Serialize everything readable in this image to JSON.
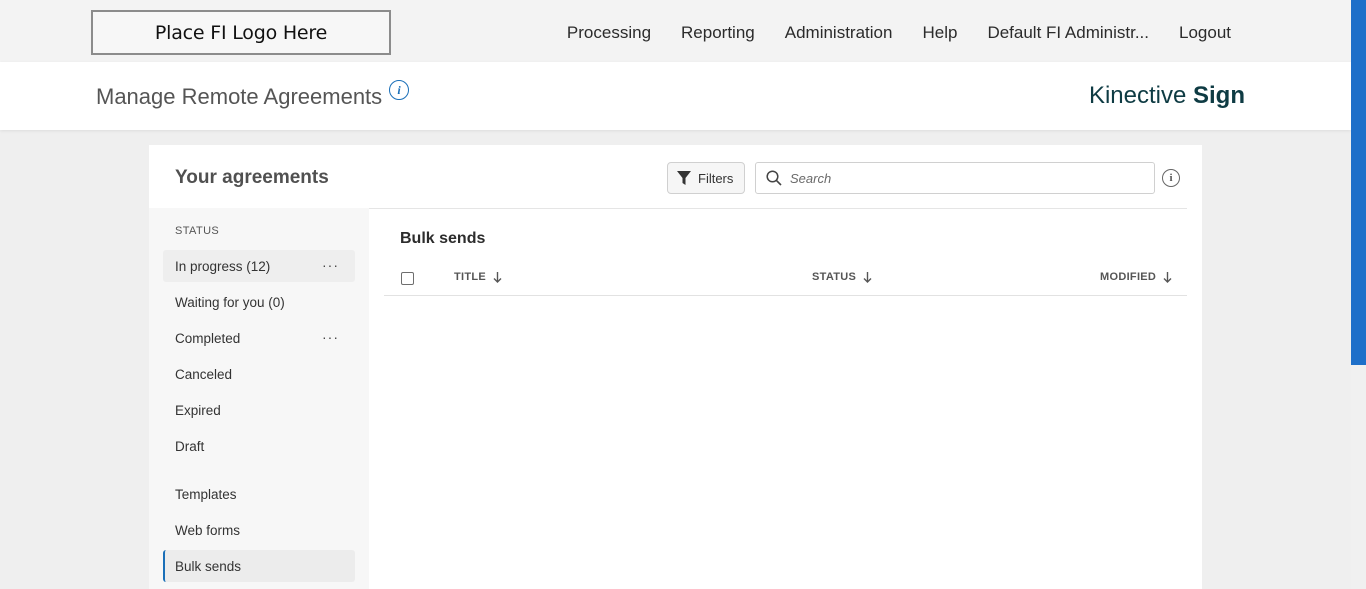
{
  "topbar": {
    "logo_text": "Place FI Logo Here",
    "nav": [
      "Processing",
      "Reporting",
      "Administration",
      "Help",
      "Default FI Administr...",
      "Logout"
    ]
  },
  "header": {
    "title": "Manage Remote Agreements",
    "brand_light": "Kinective",
    "brand_bold": "Sign"
  },
  "panel": {
    "title": "Your agreements",
    "filters_label": "Filters",
    "search_placeholder": "Search"
  },
  "sidebar": {
    "status_heading": "STATUS",
    "status_items": [
      "In progress (12)",
      "Waiting for you (0)",
      "Completed",
      "Canceled",
      "Expired",
      "Draft"
    ],
    "other_items": [
      "Templates",
      "Web forms",
      "Bulk sends"
    ],
    "selected": "Bulk sends"
  },
  "content": {
    "section_title": "Bulk sends",
    "columns": {
      "title": "TITLE",
      "status": "STATUS",
      "modified": "MODIFIED"
    }
  },
  "colors": {
    "accent": "#1a6fb8",
    "scrollbar_thumb": "#1e6fc9",
    "brand": "#0e3b43"
  }
}
